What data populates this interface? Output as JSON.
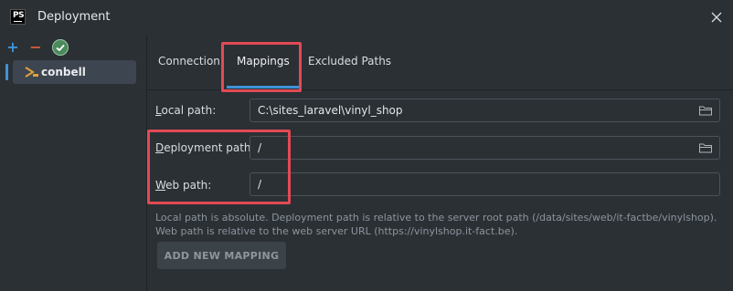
{
  "window": {
    "app_icon_text": "PS",
    "title": "Deployment",
    "close_icon": "close-icon"
  },
  "toolbar": {
    "add_icon": "plus-icon",
    "remove_icon": "minus-icon",
    "check_icon": "check-circle-icon",
    "add_label": "+",
    "remove_label": "−"
  },
  "servers": [
    {
      "label": "conbell",
      "icon": "sftp-server-icon",
      "selected": true
    }
  ],
  "tabs": [
    {
      "label": "Connection",
      "active": false
    },
    {
      "label": "Mappings",
      "active": true
    },
    {
      "label": "Excluded Paths",
      "active": false
    }
  ],
  "mapping": {
    "local_path_label_prefix": "L",
    "local_path_label_rest": "ocal path:",
    "local_path_value": "C:\\sites_laravel\\vinyl_shop",
    "deployment_path_label_prefix": "D",
    "deployment_path_label_rest": "eployment path:",
    "deployment_path_value": "/",
    "web_path_label_prefix": "W",
    "web_path_label_rest": "eb path:",
    "web_path_value": "/"
  },
  "help": {
    "line1": "Local path is absolute. Deployment path is relative to the server root path (/data/sites/web/it-factbe/vinylshop).",
    "line2": "Web path is relative to the web server URL (https://vinylshop.it-fact.be)."
  },
  "add_mapping_label": "ADD NEW MAPPING",
  "colors": {
    "accent": "#3f93d6",
    "highlight": "#e24a55",
    "background": "#2b3035"
  }
}
